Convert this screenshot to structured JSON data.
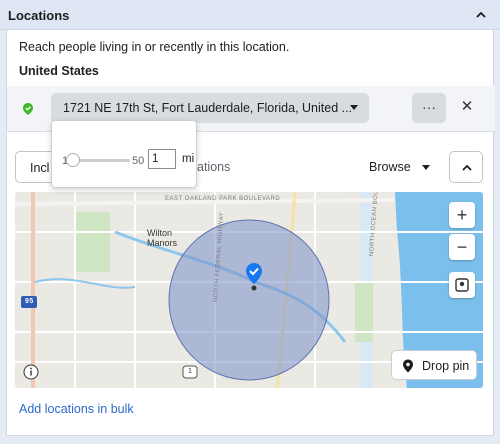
{
  "section": {
    "title": "Locations"
  },
  "description": "Reach people living in or recently in this location.",
  "country": "United States",
  "location": {
    "address": "1721 NE 17th St, Fort Lauderdale, Florida, United ...",
    "more_label": "···",
    "remove_label": "✕"
  },
  "radius": {
    "min": "1",
    "max": "50",
    "value": "1",
    "unit": "mi",
    "level_fraction": 0.0
  },
  "include": {
    "label": "Incl",
    "search_rest": "ations",
    "browse_label": "Browse"
  },
  "map": {
    "labels": {
      "boulevard": "EAST OAKLAND PARK BOULEVARD",
      "place": "Wilton Manors",
      "highway": "NORTH FEDERAL HIGHWAY",
      "ocean": "NORTH OCEAN BOULEVARD",
      "interstate": "95",
      "route": "1"
    },
    "zoom_in": "+",
    "zoom_out": "−",
    "drop_pin_label": "Drop pin"
  },
  "bulk_link": "Add locations in bulk",
  "colors": {
    "accent": "#1877f2",
    "circle": "#7a8fc9",
    "water": "#6fb4e8",
    "pin_green": "#42b72a"
  },
  "icons": [
    "chevron-up-icon",
    "location-pin-icon",
    "caret-down-icon",
    "close-icon",
    "locate-icon",
    "info-icon",
    "map-pin-icon"
  ]
}
